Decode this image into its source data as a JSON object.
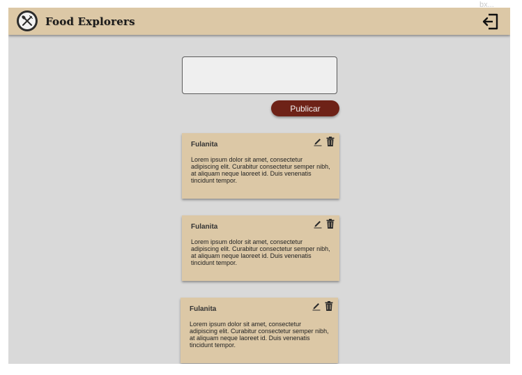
{
  "corner_text": "bx...",
  "header": {
    "brand": "Food Explorers",
    "logo_icon": "fork-spoon-icon",
    "logout_icon": "logout-icon"
  },
  "composer": {
    "value": "",
    "placeholder": "",
    "publish_label": "Publicar",
    "publish_color": "#6e2217"
  },
  "colors": {
    "header_bg": "#dcc8a6",
    "card_bg": "#dcc8a6",
    "page_bg": "#d9d9d9"
  },
  "posts": [
    {
      "author": "Fulanita",
      "text": "Lorem ipsum dolor sit amet, consectetur adipiscing elit. Curabitur consectetur semper nibh, at aliquam neque laoreet id. Duis venenatis tincidunt tempor.",
      "edit_icon": "pencil-icon",
      "delete_icon": "trash-icon"
    },
    {
      "author": "Fulanita",
      "text": "Lorem ipsum dolor sit amet, consectetur adipiscing elit. Curabitur consectetur semper nibh, at aliquam neque laoreet id. Duis venenatis tincidunt tempor.",
      "edit_icon": "pencil-icon",
      "delete_icon": "trash-icon"
    },
    {
      "author": "Fulanita",
      "text": "Lorem ipsum dolor sit amet, consectetur adipiscing elit. Curabitur consectetur semper nibh, at aliquam neque laoreet id. Duis venenatis tincidunt tempor.",
      "edit_icon": "pencil-icon",
      "delete_icon": "trash-icon"
    }
  ]
}
